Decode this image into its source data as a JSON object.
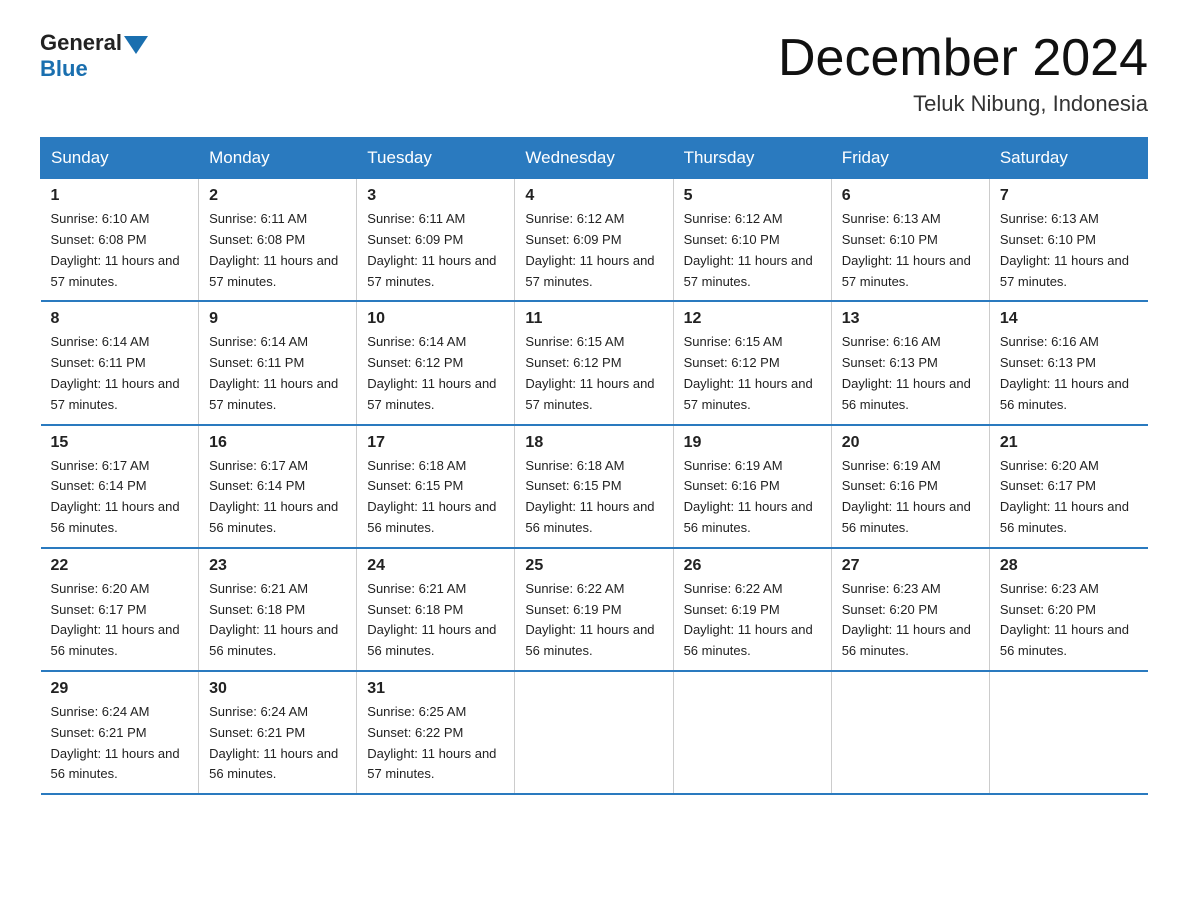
{
  "logo": {
    "general": "General",
    "blue": "Blue"
  },
  "header": {
    "month": "December 2024",
    "location": "Teluk Nibung, Indonesia"
  },
  "days_of_week": [
    "Sunday",
    "Monday",
    "Tuesday",
    "Wednesday",
    "Thursday",
    "Friday",
    "Saturday"
  ],
  "weeks": [
    [
      {
        "day": "1",
        "sunrise": "6:10 AM",
        "sunset": "6:08 PM",
        "daylight": "11 hours and 57 minutes."
      },
      {
        "day": "2",
        "sunrise": "6:11 AM",
        "sunset": "6:08 PM",
        "daylight": "11 hours and 57 minutes."
      },
      {
        "day": "3",
        "sunrise": "6:11 AM",
        "sunset": "6:09 PM",
        "daylight": "11 hours and 57 minutes."
      },
      {
        "day": "4",
        "sunrise": "6:12 AM",
        "sunset": "6:09 PM",
        "daylight": "11 hours and 57 minutes."
      },
      {
        "day": "5",
        "sunrise": "6:12 AM",
        "sunset": "6:10 PM",
        "daylight": "11 hours and 57 minutes."
      },
      {
        "day": "6",
        "sunrise": "6:13 AM",
        "sunset": "6:10 PM",
        "daylight": "11 hours and 57 minutes."
      },
      {
        "day": "7",
        "sunrise": "6:13 AM",
        "sunset": "6:10 PM",
        "daylight": "11 hours and 57 minutes."
      }
    ],
    [
      {
        "day": "8",
        "sunrise": "6:14 AM",
        "sunset": "6:11 PM",
        "daylight": "11 hours and 57 minutes."
      },
      {
        "day": "9",
        "sunrise": "6:14 AM",
        "sunset": "6:11 PM",
        "daylight": "11 hours and 57 minutes."
      },
      {
        "day": "10",
        "sunrise": "6:14 AM",
        "sunset": "6:12 PM",
        "daylight": "11 hours and 57 minutes."
      },
      {
        "day": "11",
        "sunrise": "6:15 AM",
        "sunset": "6:12 PM",
        "daylight": "11 hours and 57 minutes."
      },
      {
        "day": "12",
        "sunrise": "6:15 AM",
        "sunset": "6:12 PM",
        "daylight": "11 hours and 57 minutes."
      },
      {
        "day": "13",
        "sunrise": "6:16 AM",
        "sunset": "6:13 PM",
        "daylight": "11 hours and 56 minutes."
      },
      {
        "day": "14",
        "sunrise": "6:16 AM",
        "sunset": "6:13 PM",
        "daylight": "11 hours and 56 minutes."
      }
    ],
    [
      {
        "day": "15",
        "sunrise": "6:17 AM",
        "sunset": "6:14 PM",
        "daylight": "11 hours and 56 minutes."
      },
      {
        "day": "16",
        "sunrise": "6:17 AM",
        "sunset": "6:14 PM",
        "daylight": "11 hours and 56 minutes."
      },
      {
        "day": "17",
        "sunrise": "6:18 AM",
        "sunset": "6:15 PM",
        "daylight": "11 hours and 56 minutes."
      },
      {
        "day": "18",
        "sunrise": "6:18 AM",
        "sunset": "6:15 PM",
        "daylight": "11 hours and 56 minutes."
      },
      {
        "day": "19",
        "sunrise": "6:19 AM",
        "sunset": "6:16 PM",
        "daylight": "11 hours and 56 minutes."
      },
      {
        "day": "20",
        "sunrise": "6:19 AM",
        "sunset": "6:16 PM",
        "daylight": "11 hours and 56 minutes."
      },
      {
        "day": "21",
        "sunrise": "6:20 AM",
        "sunset": "6:17 PM",
        "daylight": "11 hours and 56 minutes."
      }
    ],
    [
      {
        "day": "22",
        "sunrise": "6:20 AM",
        "sunset": "6:17 PM",
        "daylight": "11 hours and 56 minutes."
      },
      {
        "day": "23",
        "sunrise": "6:21 AM",
        "sunset": "6:18 PM",
        "daylight": "11 hours and 56 minutes."
      },
      {
        "day": "24",
        "sunrise": "6:21 AM",
        "sunset": "6:18 PM",
        "daylight": "11 hours and 56 minutes."
      },
      {
        "day": "25",
        "sunrise": "6:22 AM",
        "sunset": "6:19 PM",
        "daylight": "11 hours and 56 minutes."
      },
      {
        "day": "26",
        "sunrise": "6:22 AM",
        "sunset": "6:19 PM",
        "daylight": "11 hours and 56 minutes."
      },
      {
        "day": "27",
        "sunrise": "6:23 AM",
        "sunset": "6:20 PM",
        "daylight": "11 hours and 56 minutes."
      },
      {
        "day": "28",
        "sunrise": "6:23 AM",
        "sunset": "6:20 PM",
        "daylight": "11 hours and 56 minutes."
      }
    ],
    [
      {
        "day": "29",
        "sunrise": "6:24 AM",
        "sunset": "6:21 PM",
        "daylight": "11 hours and 56 minutes."
      },
      {
        "day": "30",
        "sunrise": "6:24 AM",
        "sunset": "6:21 PM",
        "daylight": "11 hours and 56 minutes."
      },
      {
        "day": "31",
        "sunrise": "6:25 AM",
        "sunset": "6:22 PM",
        "daylight": "11 hours and 57 minutes."
      },
      null,
      null,
      null,
      null
    ]
  ]
}
